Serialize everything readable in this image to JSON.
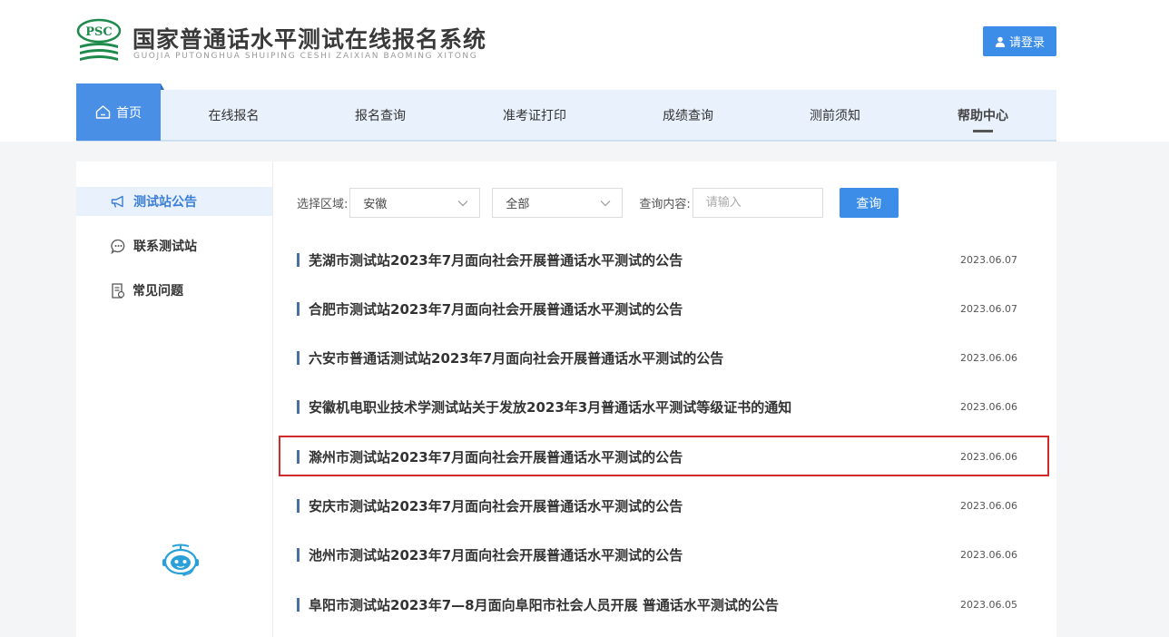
{
  "header": {
    "logo_mark_text": "PSC",
    "title": "国家普通话水平测试在线报名系统",
    "subtitle": "GUOJIA PUTONGHUA SHUIPING CESHI ZAIXIAN BAOMING XITONG",
    "login_label": "请登录"
  },
  "nav": {
    "items": [
      {
        "label": "首页",
        "icon": "home-icon"
      },
      {
        "label": "在线报名"
      },
      {
        "label": "报名查询"
      },
      {
        "label": "准考证打印"
      },
      {
        "label": "成绩查询"
      },
      {
        "label": "测前须知"
      },
      {
        "label": "帮助中心"
      }
    ]
  },
  "sidebar": {
    "items": [
      {
        "label": "测试站公告",
        "icon": "megaphone-icon",
        "active": true
      },
      {
        "label": "联系测试站",
        "icon": "chat-icon"
      },
      {
        "label": "常见问题",
        "icon": "document-icon"
      }
    ],
    "robot_icon": "robot-assistant-icon"
  },
  "filter": {
    "region_label": "选择区域:",
    "region_value": "安徽",
    "scope_value": "全部",
    "query_label": "查询内容:",
    "query_placeholder": "请输入",
    "query_button": "查询"
  },
  "announcements": [
    {
      "title": "芜湖市测试站2023年7月面向社会开展普通话水平测试的公告",
      "date": "2023.06.07"
    },
    {
      "title": "合肥市测试站2023年7月面向社会开展普通话水平测试的公告",
      "date": "2023.06.07"
    },
    {
      "title": "六安市普通话测试站2023年7月面向社会开展普通话水平测试的公告",
      "date": "2023.06.06"
    },
    {
      "title": "安徽机电职业技术学测试站关于发放2023年3月普通话水平测试等级证书的通知",
      "date": "2023.06.06"
    },
    {
      "title": "滁州市测试站2023年7月面向社会开展普通话水平测试的公告",
      "date": "2023.06.06"
    },
    {
      "title": "安庆市测试站2023年7月面向社会开展普通话水平测试的公告",
      "date": "2023.06.06"
    },
    {
      "title": "池州市测试站2023年7月面向社会开展普通话水平测试的公告",
      "date": "2023.06.06"
    },
    {
      "title": "阜阳市测试站2023年7—8月面向阜阳市社会人员开展 普通话水平测试的公告",
      "date": "2023.06.05"
    }
  ],
  "colors": {
    "accent": "#3b8de8",
    "nav_bg": "#e8f1fc",
    "highlight_border": "#d02a2a"
  }
}
